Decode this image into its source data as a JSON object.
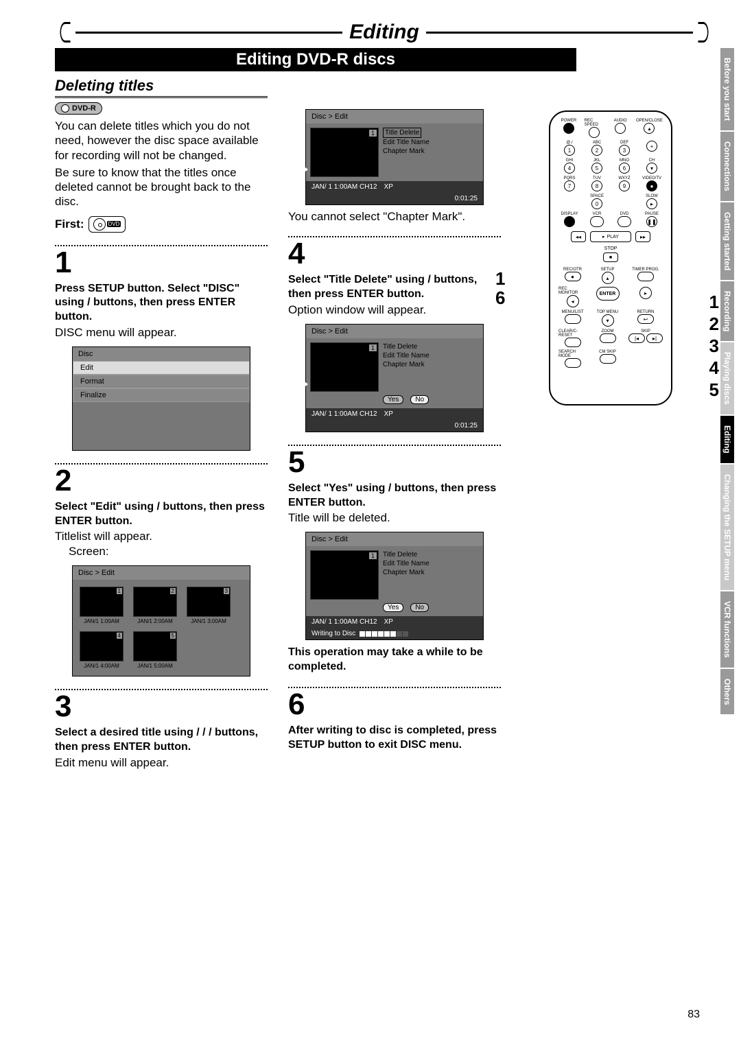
{
  "chapter_title": "Editing",
  "page_title": "Editing DVD-R discs",
  "section_heading": "Deleting titles",
  "disc_badge": "DVD-R",
  "intro_p1": "You can delete titles which you do not need, however the disc space available for recording will not be changed.",
  "intro_p2": "Be sure to know that the titles once deleted cannot be brought back to the disc.",
  "first_label": "First:",
  "disc_icon_text": "DVD",
  "steps": {
    "s1": {
      "num": "1",
      "bold": "Press SETUP button. Select \"DISC\" using      /      buttons, then press ENTER button.",
      "after": "DISC menu will appear."
    },
    "s2": {
      "num": "2",
      "bold": "Select \"Edit\" using      /      buttons, then press ENTER button.",
      "after": "Titlelist will appear.",
      "after2": "Screen:"
    },
    "s3": {
      "num": "3",
      "bold": "Select a desired title using      /      /      /      buttons, then press ENTER button.",
      "after": "Edit menu will appear."
    },
    "s4": {
      "num": "4",
      "bold": "Select \"Title Delete\" using      /      buttons, then press ENTER button.",
      "after": "Option window will appear."
    },
    "s5": {
      "num": "5",
      "bold": "Select \"Yes\" using      /      buttons, then press ENTER button.",
      "after": "Title will be deleted."
    },
    "s6": {
      "num": "6",
      "bold": "After writing to disc is completed, press SETUP button to exit DISC menu."
    }
  },
  "col2_top_note": "You cannot select \"Chapter Mark\".",
  "note_after_5": "This operation may take a while to be completed.",
  "osd": {
    "head": "Disc > Edit",
    "menu_items": {
      "a": "Title Delete",
      "b": "Edit Title Name",
      "c": "Chapter Mark"
    },
    "status_date": "JAN/ 1   1:00AM  CH12",
    "status_mode": "XP",
    "status_time": "0:01:25",
    "yes": "Yes",
    "no": "No",
    "writing": "Writing to Disc",
    "disc_menu_head": "Disc",
    "disc_menu": {
      "a": "Edit",
      "b": "Format",
      "c": "Finalize"
    },
    "thumbs": [
      {
        "n": "1",
        "cap": "JAN/1   1:00AM"
      },
      {
        "n": "2",
        "cap": "JAN/1   2:00AM"
      },
      {
        "n": "3",
        "cap": "JAN/1   3:00AM"
      },
      {
        "n": "4",
        "cap": "JAN/1   4:00AM"
      },
      {
        "n": "5",
        "cap": "JAN/1   5:00AM"
      }
    ]
  },
  "remote": {
    "row1": [
      "POWER",
      "REC SPEED",
      "AUDIO",
      "OPEN/CLOSE"
    ],
    "row2_labels": [
      "@./",
      "ABC",
      "DEF",
      ""
    ],
    "row2": [
      "1",
      "2",
      "3",
      "+"
    ],
    "row3_labels": [
      "GHI",
      "JKL",
      "MNO",
      "CH"
    ],
    "row3": [
      "4",
      "5",
      "6",
      "▾"
    ],
    "row4_labels": [
      "PQRS",
      "TUV",
      "WXYZ",
      "VIDEO/TV"
    ],
    "row4": [
      "7",
      "8",
      "9",
      "●"
    ],
    "row5_labels": [
      "",
      "SPACE",
      "",
      "SLOW"
    ],
    "row5": [
      "",
      "0",
      "",
      "▸"
    ],
    "row6_labels": [
      "DISPLAY",
      "VCR",
      "DVD",
      "PAUSE"
    ],
    "row6": [
      "●",
      "⏺",
      "⏺",
      "❚❚"
    ],
    "play": "PLAY",
    "stop": "STOP",
    "rowA_labels": [
      "REC/OTR",
      "SETUP",
      "",
      "TIMER PROG."
    ],
    "rowB_labels": [
      "REC MONITOR",
      "",
      "ENTER",
      ""
    ],
    "rowC_labels": [
      "MENU/LIST",
      "TOP MENU",
      "",
      "RETURN"
    ],
    "rowD_labels": [
      "CLEAR/C-RESET",
      "ZOOM",
      "",
      "SKIP"
    ],
    "rowE_labels": [
      "SEARCH MODE",
      "CM SKIP",
      "",
      ""
    ]
  },
  "remote_callouts_left": {
    "a": "1",
    "b": "6"
  },
  "remote_callouts_right": {
    "a": "1",
    "b": "2",
    "c": "3",
    "d": "4",
    "e": "5"
  },
  "tabs": [
    "Before you start",
    "Connections",
    "Getting started",
    "Recording",
    "Playing discs",
    "Editing",
    "Changing the SETUP menu",
    "VCR functions",
    "Others"
  ],
  "page_number": "83"
}
